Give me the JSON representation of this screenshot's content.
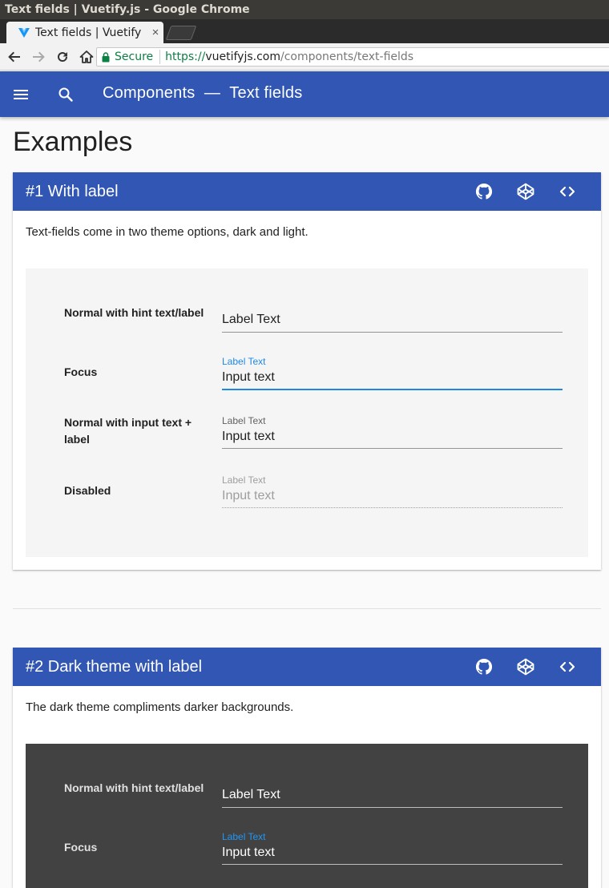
{
  "window": {
    "title": "Text fields | Vuetify.js - Google Chrome"
  },
  "tab": {
    "title": "Text fields | Vuetify",
    "close": "×"
  },
  "omnibox": {
    "secure_label": "Secure",
    "url_scheme": "https://",
    "url_host": "vuetifyjs.com",
    "url_path": "/components/text-fields"
  },
  "appbar": {
    "title": "Components  —  Text fields"
  },
  "page": {
    "heading": "Examples"
  },
  "examples": [
    {
      "title": "#1 With label",
      "description": "Text-fields come in two theme options, dark and light.",
      "theme": "light",
      "rows": [
        {
          "label": "Normal with hint text/label",
          "state": "hint",
          "field_label": "Label Text"
        },
        {
          "label": "Focus",
          "state": "focus",
          "field_label": "Label Text",
          "value": "Input text"
        },
        {
          "label": "Normal with input text + label",
          "state": "normal",
          "field_label": "Label Text",
          "value": "Input text"
        },
        {
          "label": "Disabled",
          "state": "disabled",
          "field_label": "Label Text",
          "value": "Input text"
        }
      ]
    },
    {
      "title": "#2 Dark theme with label",
      "description": "The dark theme compliments darker backgrounds.",
      "theme": "dark",
      "rows": [
        {
          "label": "Normal with hint text/label",
          "state": "hint",
          "field_label": "Label Text"
        },
        {
          "label": "Focus",
          "state": "focus",
          "field_label": "Label Text",
          "value": "Input text"
        }
      ]
    }
  ],
  "colors": {
    "primary": "#3156b3",
    "focus_blue": "#1e88e5",
    "dark_panel": "#424242",
    "light_panel": "#f5f5f5"
  },
  "icons": [
    "menu-icon",
    "search-icon",
    "github-icon",
    "codepen-icon",
    "code-icon",
    "lock-icon",
    "back-icon",
    "forward-icon",
    "reload-icon",
    "home-icon"
  ]
}
